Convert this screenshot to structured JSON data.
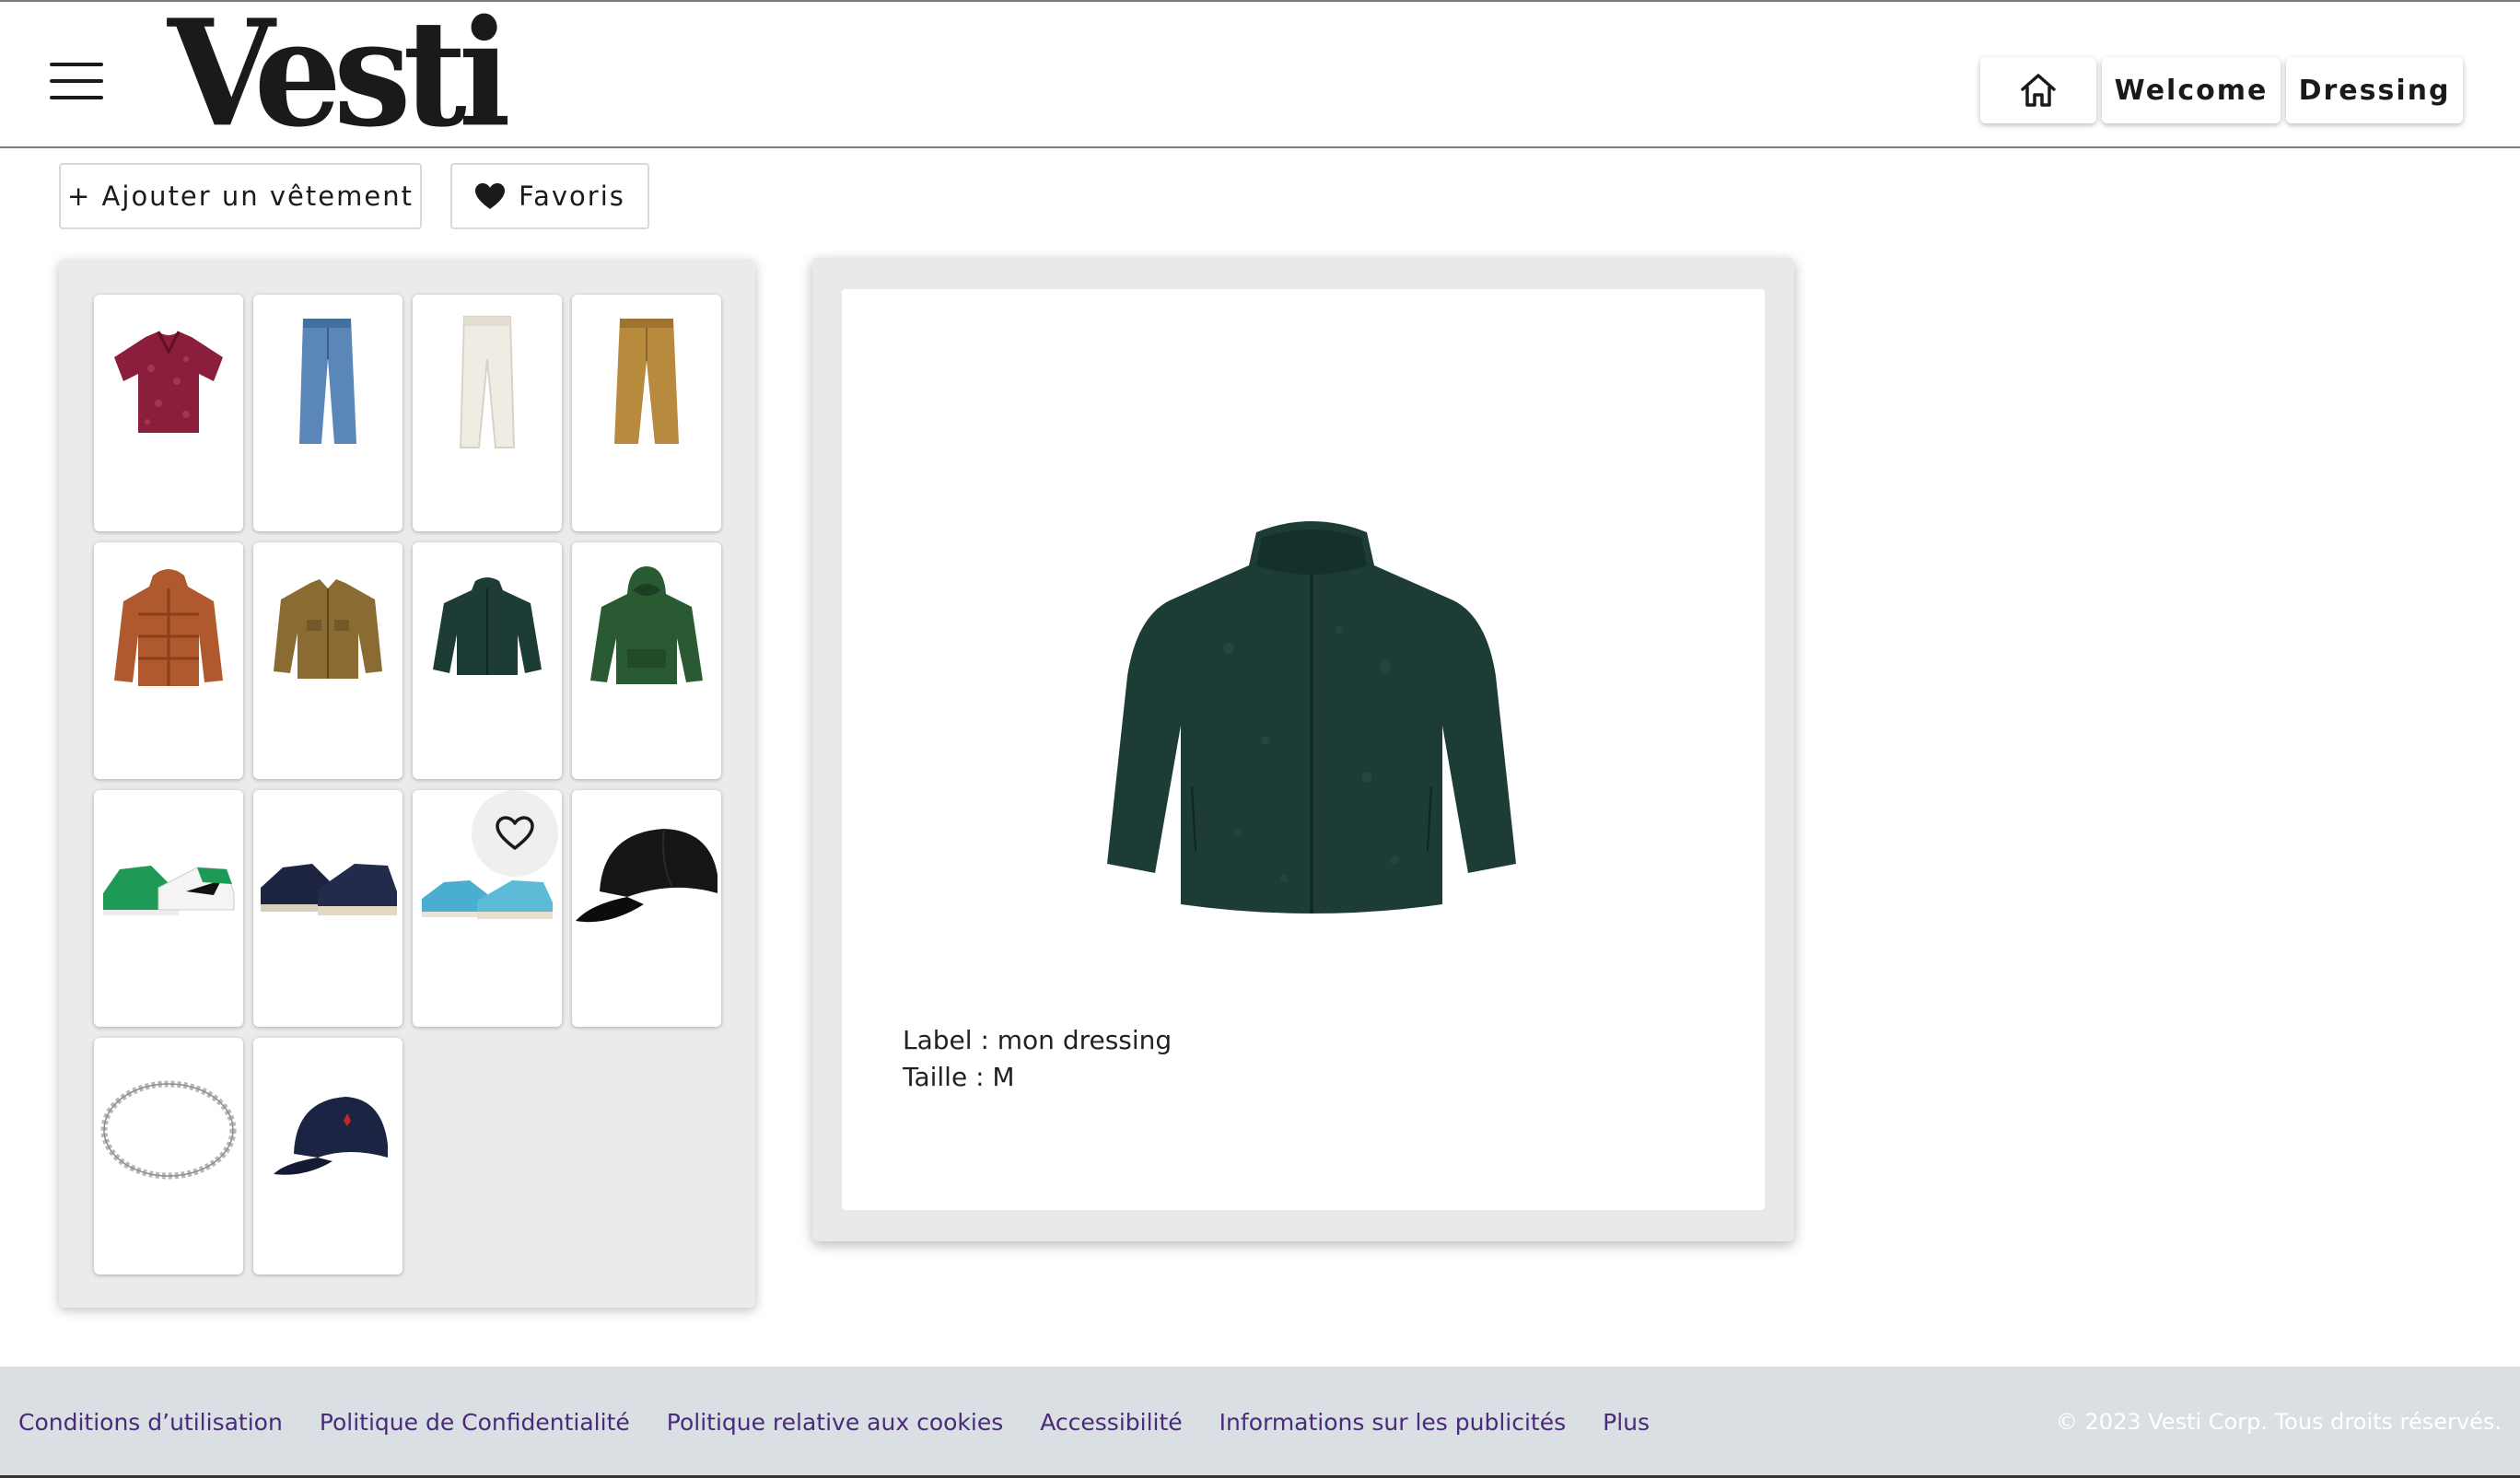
{
  "header": {
    "logo": "Vesti",
    "nav": {
      "welcome": "Welcome",
      "dressing": "Dressing"
    }
  },
  "toolbar": {
    "add_label": "+ Ajouter un vêtement",
    "favorites_label": "Favoris"
  },
  "wardrobe": {
    "items": [
      {
        "name": "red-print-shirt",
        "color": "#8b1e3a"
      },
      {
        "name": "blue-jeans",
        "color": "#5a86b8"
      },
      {
        "name": "white-jeans",
        "color": "#efece4"
      },
      {
        "name": "khaki-pants",
        "color": "#b88a3e"
      },
      {
        "name": "orange-puffer-jacket",
        "color": "#b0582e"
      },
      {
        "name": "brown-corduroy-jacket",
        "color": "#8a6b32"
      },
      {
        "name": "green-fleece-jacket",
        "color": "#1e3c36"
      },
      {
        "name": "green-hoodie",
        "color": "#2a5a32"
      },
      {
        "name": "green-sneakers",
        "color": "#1e9a56"
      },
      {
        "name": "navy-running-shoes",
        "color": "#1c2440"
      },
      {
        "name": "turquoise-running-shoes",
        "color": "#4aaed0"
      },
      {
        "name": "black-cap",
        "color": "#161616"
      },
      {
        "name": "silver-chain-necklace",
        "color": "#b8b8b8"
      },
      {
        "name": "navy-cap",
        "color": "#1c2444"
      }
    ]
  },
  "detail": {
    "label_line": "Label : mon dressing",
    "size_line": "Taille : M",
    "color": "#1e3c36"
  },
  "footer": {
    "links": [
      "Conditions d’utilisation",
      "Politique de Confidentialité",
      "Politique relative aux cookies",
      "Accessibilité",
      "Informations sur les publicités",
      "Plus"
    ],
    "copyright": "© 2023 Vesti Corp. Tous droits réservés."
  }
}
